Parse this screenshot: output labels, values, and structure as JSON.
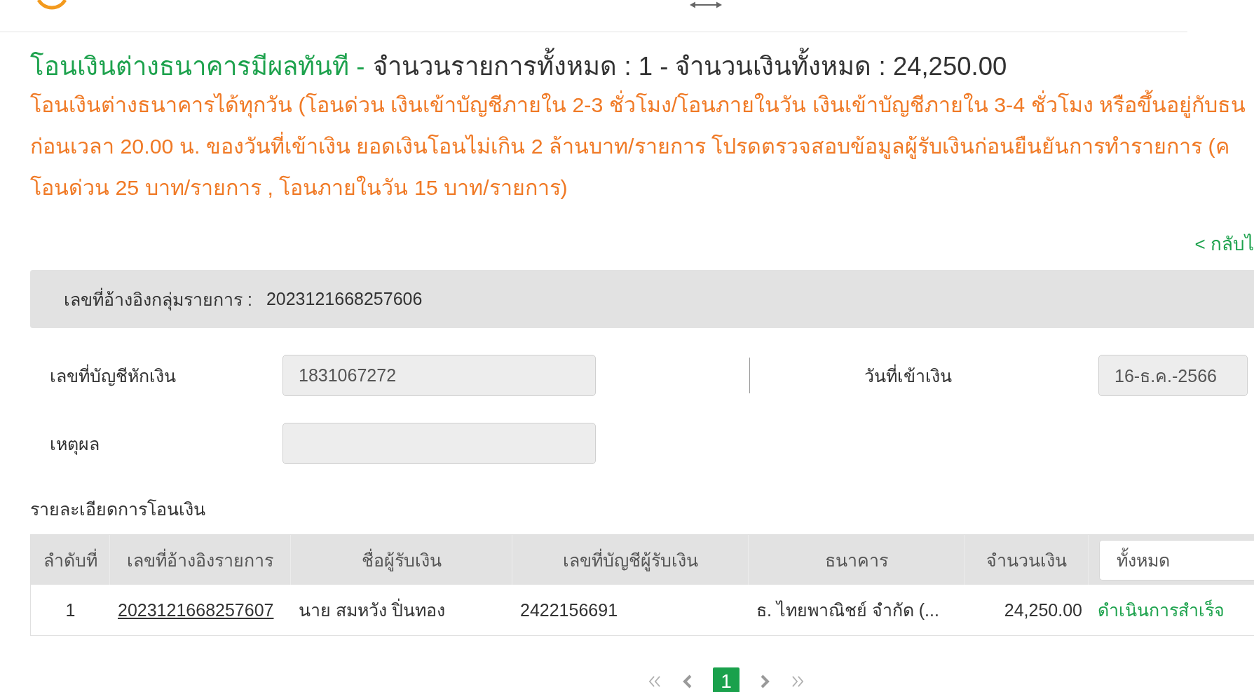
{
  "header": {
    "title": "โอนเงินต่างธนาคารมีผลทันที -",
    "summary": "จำนวนรายการทั้งหมด : 1 - จำนวนเงินทั้งหมด : 24,250.00"
  },
  "notice_lines": [
    "โอนเงินต่างธนาคารได้ทุกวัน (โอนด่วน เงินเข้าบัญชีภายใน 2-3 ชั่วโมง/โอนภายในวัน เงินเข้าบัญชีภายใน 3-4 ชั่วโมง หรือขึ้นอยู่กับธน",
    "ก่อนเวลา 20.00 น. ของวันที่เข้าเงิน ยอดเงินโอนไม่เกิน 2 ล้านบาท/รายการ โปรดตรวจสอบข้อมูลผู้รับเงินก่อนยืนยันการทำรายการ (ค",
    "โอนด่วน 25 บาท/รายการ , โอนภายในวัน 15 บาท/รายการ)"
  ],
  "back_link": "< กลับไ",
  "group_ref": {
    "label": "เลขที่อ้างอิงกลุ่มรายการ :",
    "value": "2023121668257606"
  },
  "form": {
    "debit_account": {
      "label": "เลขที่บัญชีหักเงิน",
      "value": "1831067272",
      "disabled": true
    },
    "transfer_date": {
      "label": "วันที่เข้าเงิน",
      "value": "16-ธ.ค.-2566",
      "disabled": true
    },
    "reason": {
      "label": "เหตุผล",
      "disabled": true
    }
  },
  "details_title": "รายละเอียดการโอนเงิน",
  "table": {
    "columns": [
      "ลำดับที่",
      "เลขที่อ้างอิงรายการ",
      "ชื่อผู้รับเงิน",
      "เลขที่บัญชีผู้รับเงิน",
      "ธนาคาร",
      "จำนวนเงิน"
    ],
    "status_filter": {
      "value": "ทั้งหมด"
    },
    "rows": [
      {
        "index": "1",
        "reference": "2023121668257607",
        "recipient_name": "นาย สมหวัง ปิ่นทอง",
        "recipient_account": "2422156691",
        "bank": "ธ. ไทยพาณิชย์ จำกัด (...",
        "amount": "24,250.00",
        "status": "ดำเนินการสำเร็จ"
      }
    ]
  },
  "pagination": {
    "pages": [
      {
        "label": "1",
        "selected": true
      }
    ]
  }
}
